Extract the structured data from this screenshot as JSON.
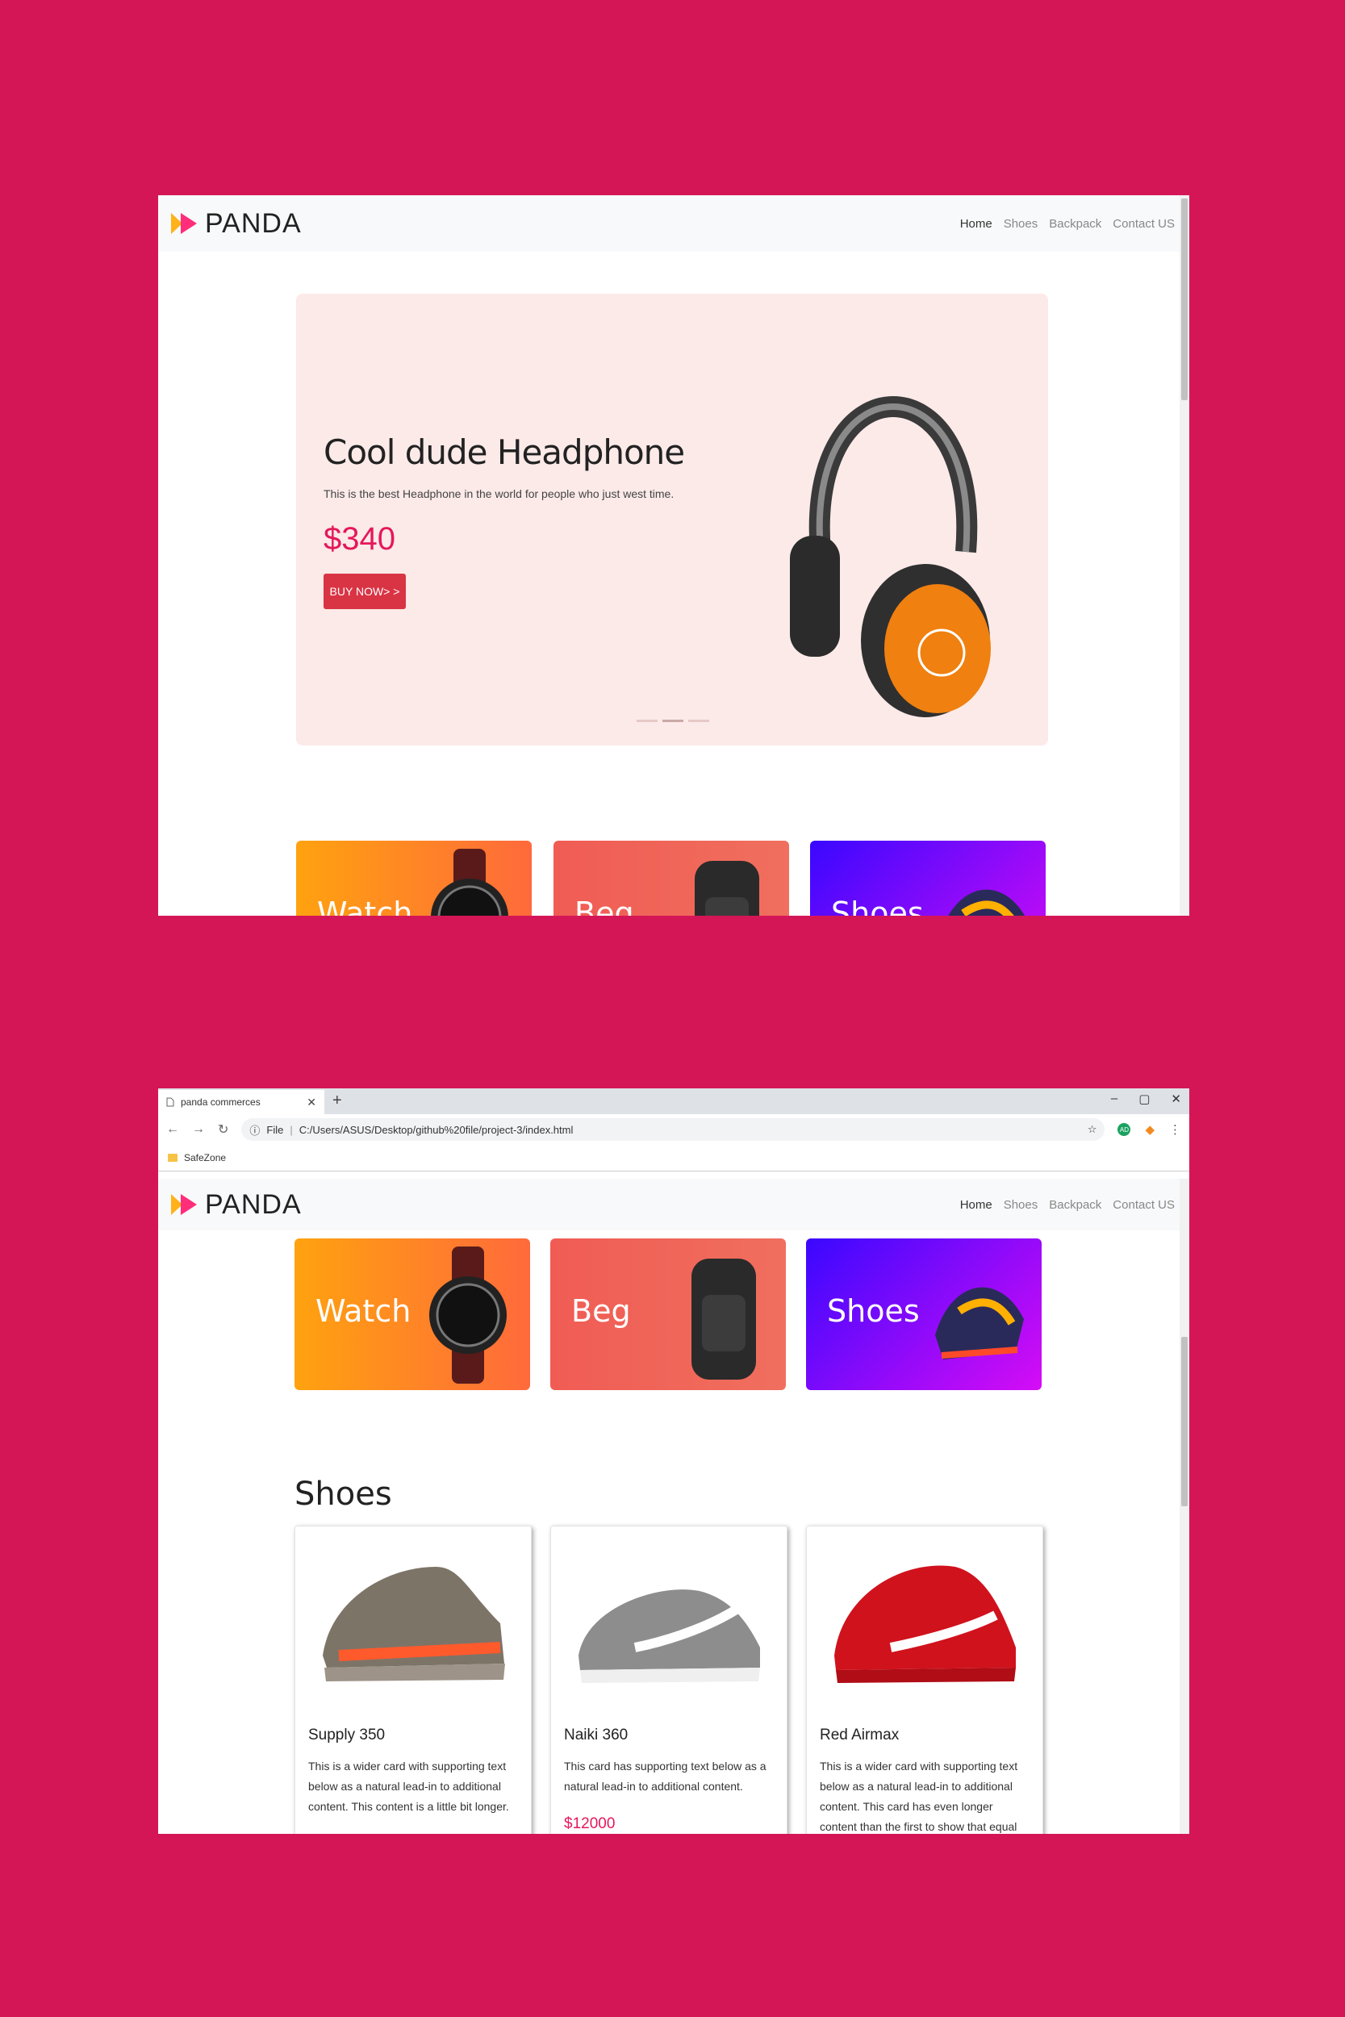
{
  "brand": {
    "name": "PANDA"
  },
  "nav": {
    "items": [
      {
        "label": "Home",
        "active": true
      },
      {
        "label": "Shoes"
      },
      {
        "label": "Backpack"
      },
      {
        "label": "Contact US"
      }
    ]
  },
  "hero": {
    "title": "Cool dude Headphone",
    "text": "This is the best Headphone in the world for people who just west time.",
    "price": "$340",
    "button": "BUY NOW> >"
  },
  "categories": [
    {
      "label": "Watch"
    },
    {
      "label": "Beg"
    },
    {
      "label": "Shoes"
    }
  ],
  "browser": {
    "tab_title": "panda commerces",
    "address_scheme": "File",
    "address": "C:/Users/ASUS/Desktop/github%20file/project-3/index.html",
    "bookmark": "SafeZone",
    "extension_badge": "AD"
  },
  "products": {
    "section_title": "Shoes",
    "items": [
      {
        "name": "Supply 350",
        "text": "This is a wider card with supporting text below as a natural lead-in to additional content. This content is a little bit longer."
      },
      {
        "name": "Naiki 360",
        "text": "This card has supporting text below as a natural lead-in to additional content.",
        "price": "$12000"
      },
      {
        "name": "Red Airmax",
        "text": "This is a wider card with supporting text below as a natural lead-in to additional content. This card has even longer content than the first to show that equal height"
      }
    ]
  },
  "colors": {
    "background": "#d41657",
    "accent": "#e5185b",
    "button": "#d93444"
  }
}
